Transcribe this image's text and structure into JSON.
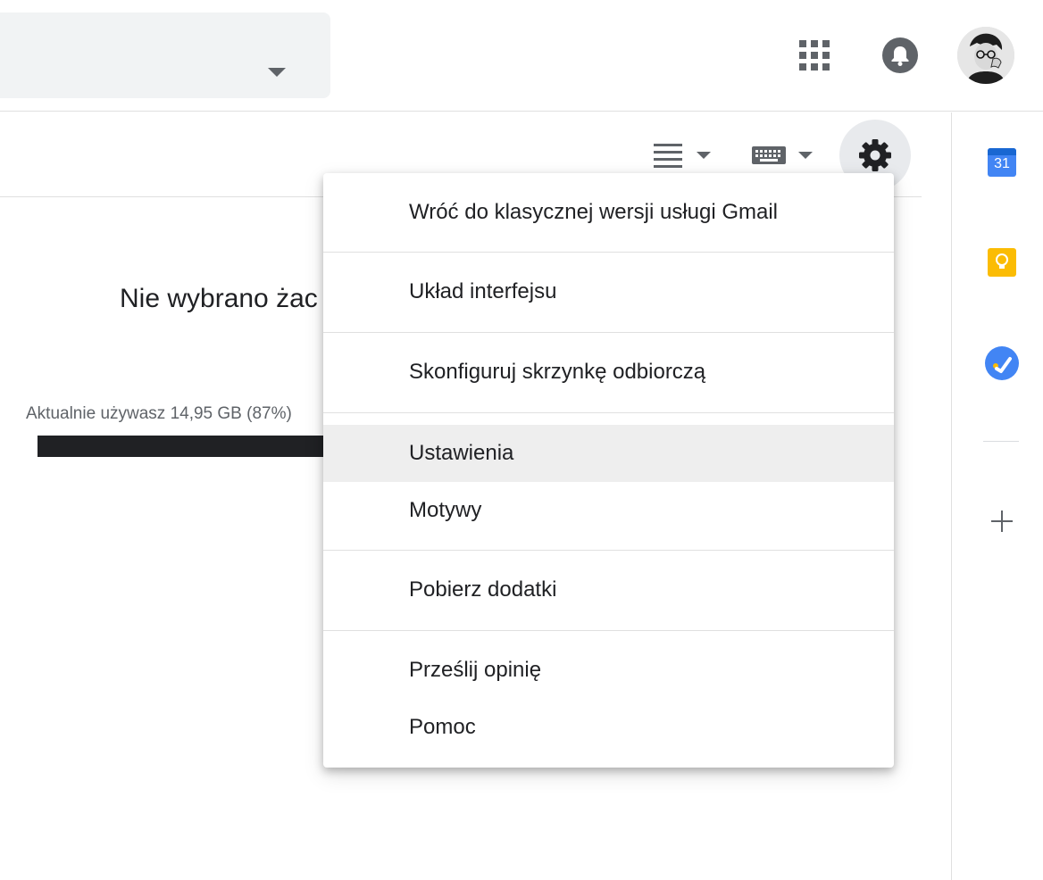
{
  "header": {
    "search_caret_icon": "chevron-down-icon",
    "apps_icon": "apps-grid-icon",
    "notifications_icon": "bell-icon",
    "avatar_icon": "user-avatar"
  },
  "toolbar": {
    "density_icon": "density-list-icon",
    "keyboard_icon": "keyboard-icon",
    "settings_icon": "gear-icon"
  },
  "main": {
    "no_selection_text": "Nie wybrano żac",
    "storage_text": "Aktualnie używasz 14,95 GB (87%)",
    "storage_used_percent": 87
  },
  "side_panel": {
    "calendar_day": "31",
    "icons": [
      "calendar-icon",
      "keep-icon",
      "tasks-icon",
      "plus-icon"
    ]
  },
  "settings_menu": {
    "items": [
      {
        "label": "Wróć do klasycznej wersji usługi Gmail"
      },
      {
        "label": "Układ interfejsu"
      },
      {
        "label": "Skonfiguruj skrzynkę odbiorczą"
      },
      {
        "label": "Ustawienia"
      },
      {
        "label": "Motywy"
      },
      {
        "label": "Pobierz dodatki"
      },
      {
        "label": "Prześlij opinię"
      },
      {
        "label": "Pomoc"
      }
    ],
    "highlighted_item": "Ustawienia"
  },
  "colors": {
    "icon_gray": "#5f6368",
    "text_dark": "#202124",
    "calendar_blue": "#4285f4",
    "keep_yellow": "#fbbc04",
    "menu_hover": "#eeeeee"
  }
}
